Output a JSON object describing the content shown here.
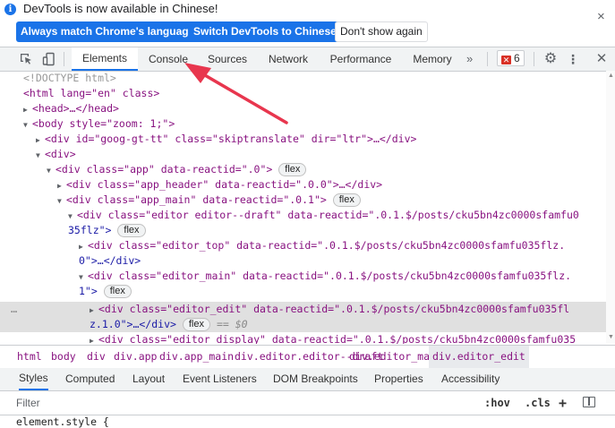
{
  "infobar": {
    "message": "DevTools is now available in Chinese!",
    "buttons": [
      "Always match Chrome's language",
      "Switch DevTools to Chinese",
      "Don't show again"
    ],
    "close": "×"
  },
  "toolbar": {
    "tabs": [
      "Elements",
      "Console",
      "Sources",
      "Network",
      "Performance",
      "Memory"
    ],
    "active_tab": "Elements",
    "more_tabs": "»",
    "error_count": "6"
  },
  "tree": [
    "<!DOCTYPE html>",
    "<html lang=\"en\" class>",
    "<head>…</head>",
    "<body style=\"zoom: 1;\">",
    "<div id=\"goog-gt-tt\" class=\"skiptranslate\" dir=\"ltr\">…</div>",
    "<div>",
    "<div class=\"app\" data-reactid=\".0\">",
    "<div class=\"app_header\" data-reactid=\".0.0\">…</div>",
    "<div class=\"app_main\" data-reactid=\".0.1\">",
    "<div class=\"editor editor--draft\" data-reactid=\".0.1.$/posts/cku5bn4zc0000sfamfu0",
    "35flz\">",
    "<div class=\"editor_top\" data-reactid=\".0.1.$/posts/cku5bn4zc0000sfamfu035flz.",
    "0\">…</div>",
    "<div class=\"editor_main\" data-reactid=\".0.1.$/posts/cku5bn4zc0000sfamfu035flz.",
    "1\">",
    "<div class=\"editor_edit\" data-reactid=\".0.1.$/posts/cku5bn4zc0000sfamfu035fl",
    "z.1.0\">…</div>",
    "<div class=\"editor display\" data-reactid=\".0.1.$/posts/cku5bn4zc0000sfamfu035"
  ],
  "pill_label": "flex",
  "selected_marker": "== $0",
  "gutter_dots": "…",
  "breadcrumbs": [
    "html",
    "body",
    "div",
    "div.app",
    "div.app_main",
    "div.editor.editor--draft",
    "div.editor_main",
    "div.editor_edit"
  ],
  "subtabs": [
    "Styles",
    "Computed",
    "Layout",
    "Event Listeners",
    "DOM Breakpoints",
    "Properties",
    "Accessibility"
  ],
  "active_subtab": "Styles",
  "filter": {
    "placeholder": "Filter",
    "hov": ":hov",
    "cls": ".cls",
    "plus": "+"
  },
  "element_style": "element.style {",
  "colors": {
    "accent": "#1a73e8",
    "tag": "#881280",
    "attr_name": "#994500",
    "attr_value": "#1a1aa6",
    "arrow": "#e8364e"
  }
}
